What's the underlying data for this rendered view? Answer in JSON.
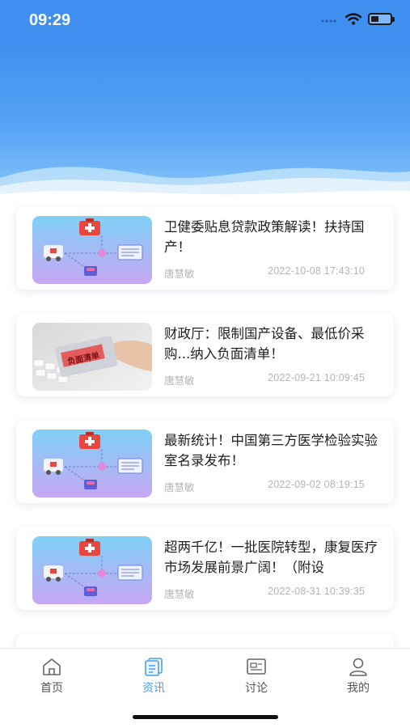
{
  "status_bar": {
    "time": "09:29"
  },
  "articles": [
    {
      "title": "卫健委贴息贷款政策解读！扶持国产！",
      "author": "唐慧敏",
      "date": "2022-10-08 17:43:10",
      "thumb": "medical-network-illustration"
    },
    {
      "title": "财政厅：限制国产设备、最低价采购...纳入负面清单！",
      "author": "唐慧敏",
      "date": "2022-09-21 10:09:45",
      "thumb": "negative-list-card-photo",
      "thumb_text": "负面清单"
    },
    {
      "title": "最新统计！中国第三方医学检验实验室名录发布！",
      "author": "唐慧敏",
      "date": "2022-09-02 08:19:15",
      "thumb": "medical-network-illustration"
    },
    {
      "title": "超两千亿！一批医院转型，康复医疗市场发展前景广阔！（附设",
      "author": "唐慧敏",
      "date": "2022-08-31 10:39:35",
      "thumb": "medical-network-illustration"
    }
  ],
  "tabs": [
    {
      "label": "首页",
      "icon": "home-icon",
      "active": false
    },
    {
      "label": "资讯",
      "icon": "news-icon",
      "active": true
    },
    {
      "label": "讨论",
      "icon": "discussion-icon",
      "active": false
    },
    {
      "label": "我的",
      "icon": "profile-icon",
      "active": false
    }
  ],
  "colors": {
    "accent": "#4a9ef0",
    "header": "#3f8ff0",
    "meta_text": "#b4b4b4"
  }
}
